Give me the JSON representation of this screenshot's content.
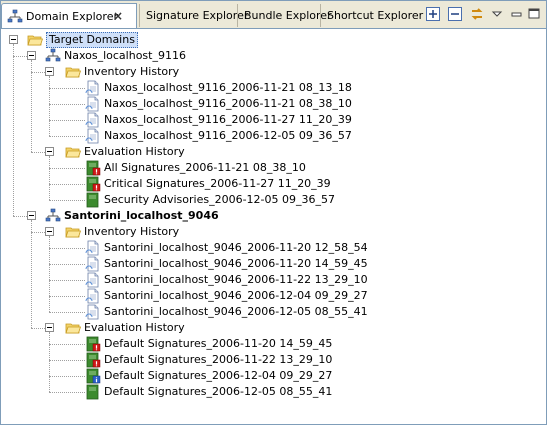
{
  "tabs": {
    "active": {
      "label": "Domain Explorer",
      "icon": "domain-explorer-icon"
    },
    "others": [
      {
        "label": "Signature Explorer"
      },
      {
        "label": "Bundle Explorer"
      },
      {
        "label": "Shortcut Explorer"
      }
    ]
  },
  "toolbar": {
    "expand_icon": "expand-all-icon",
    "collapse_icon": "collapse-all-icon",
    "link_icon": "link-with-editor-icon",
    "menu_icon": "view-menu-icon"
  },
  "tree": {
    "root_label": "Target Domains",
    "domains": [
      {
        "label": "Naxos_localhost_9116",
        "bold": false,
        "inventory_label": "Inventory History",
        "inventory": [
          "Naxos_localhost_9116_2006-11-21 08_13_18",
          "Naxos_localhost_9116_2006-11-21 08_38_10",
          "Naxos_localhost_9116_2006-11-27 11_20_39",
          "Naxos_localhost_9116_2006-12-05 09_36_57"
        ],
        "evaluation_label": "Evaluation History",
        "evaluations": [
          {
            "label": "All Signatures_2006-11-21 08_38_10",
            "status": "error"
          },
          {
            "label": "Critical Signatures_2006-11-27 11_20_39",
            "status": "error"
          },
          {
            "label": "Security Advisories_2006-12-05 09_36_57",
            "status": "ok"
          }
        ]
      },
      {
        "label": "Santorini_localhost_9046",
        "bold": true,
        "inventory_label": "Inventory History",
        "inventory": [
          "Santorini_localhost_9046_2006-11-20 12_58_54",
          "Santorini_localhost_9046_2006-11-20 14_59_45",
          "Santorini_localhost_9046_2006-11-22 13_29_10",
          "Santorini_localhost_9046_2006-12-04 09_29_27",
          "Santorini_localhost_9046_2006-12-05 08_55_41"
        ],
        "evaluation_label": "Evaluation History",
        "evaluations": [
          {
            "label": "Default Signatures_2006-11-20 14_59_45",
            "status": "error"
          },
          {
            "label": "Default Signatures_2006-11-22 13_29_10",
            "status": "error"
          },
          {
            "label": "Default Signatures_2006-12-04 09_29_27",
            "status": "info"
          },
          {
            "label": "Default Signatures_2006-12-05 08_55_41",
            "status": "ok"
          }
        ]
      }
    ]
  },
  "colors": {
    "folder": "#f2d36b",
    "folder_dark": "#c79a1e",
    "eval_green": "#3c8a2e",
    "error_red": "#d01818",
    "info_blue": "#2a5fc9",
    "selection": "#cfe0f9"
  }
}
